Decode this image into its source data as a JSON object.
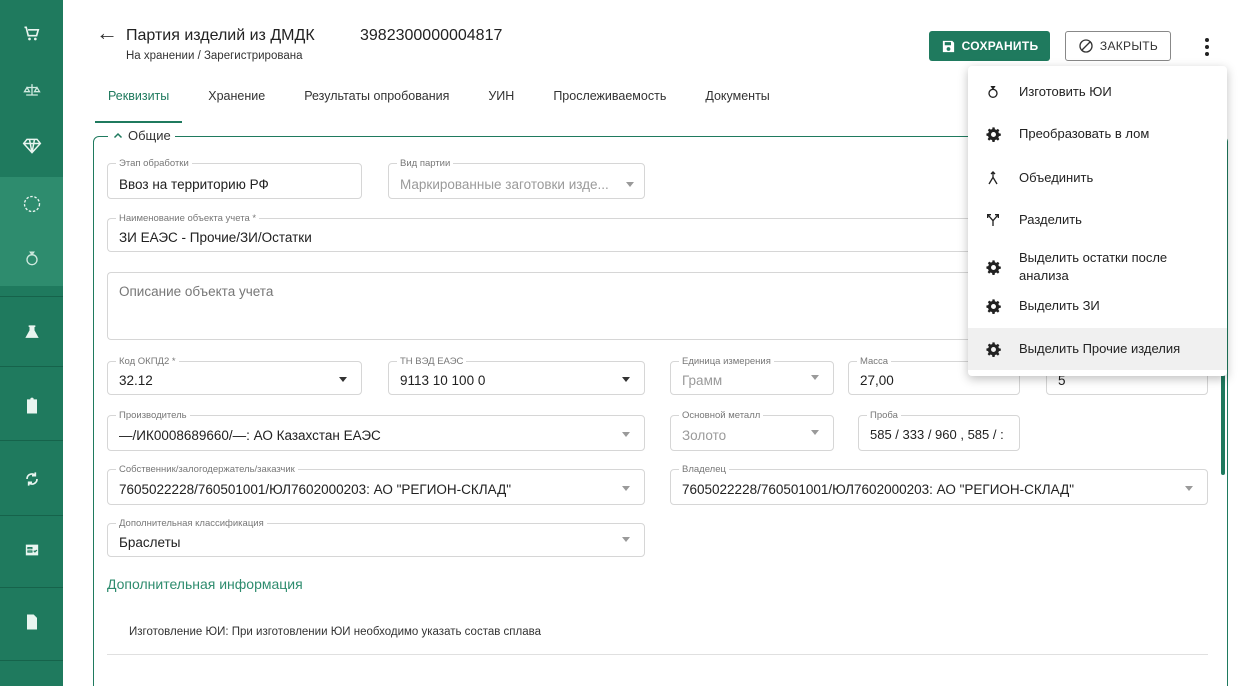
{
  "header": {
    "title": "Партия изделий из ДМДК",
    "doc_number": "3982300000004817",
    "subtitle": "На хранении / Зарегистрирована",
    "save_label": "СОХРАНИТЬ",
    "close_label": "ЗАКРЫТЬ"
  },
  "sidebar": {
    "items": [
      {
        "icon": "cart-icon"
      },
      {
        "icon": "scales-icon"
      },
      {
        "icon": "diamond-icon"
      },
      {
        "icon": "circle-dashed-icon"
      },
      {
        "icon": "ring-icon"
      },
      {
        "icon": "flask-icon"
      },
      {
        "icon": "clipboard-icon"
      },
      {
        "icon": "sync-icon"
      },
      {
        "icon": "checklist-icon"
      },
      {
        "icon": "document-icon"
      }
    ],
    "accent": "#1f7a5e"
  },
  "tabs": [
    "Реквизиты",
    "Хранение",
    "Результаты опробования",
    "УИН",
    "Прослеживаемость",
    "Документы"
  ],
  "section": {
    "title": "Общие"
  },
  "form": {
    "stage": {
      "label": "Этап обработки",
      "value": "Ввоз на территорию РФ"
    },
    "batch_type": {
      "label": "Вид партии",
      "value": "Маркированные заготовки изде..."
    },
    "object_name": {
      "label": "Наименование объекта учета *",
      "value": "ЗИ ЕАЭС - Прочие/ЗИ/Остатки"
    },
    "description": {
      "placeholder": "Описание объекта учета"
    },
    "okpd2": {
      "label": "Код ОКПД2 *",
      "value": "32.12"
    },
    "tn_ved": {
      "label": "ТН ВЭД ЕАЭС",
      "value": "9113 10 100 0"
    },
    "unit": {
      "label": "Единица измерения",
      "value": "Грамм"
    },
    "mass": {
      "label": "Масса",
      "value": "27,00"
    },
    "quantity": {
      "value": "5"
    },
    "manufacturer": {
      "label": "Производитель",
      "value": "—/ИК0008689660/—: АО Казахстан ЕАЭС"
    },
    "main_metal": {
      "label": "Основной металл",
      "value": "Золото"
    },
    "probe": {
      "label": "Проба",
      "value": "585 / 333 / 960 , 585 / :"
    },
    "owner_pledge": {
      "label": "Собственник/залогодержатель/заказчик",
      "value": "7605022228/760501001/ЮЛ7602000203: АО \"РЕГИОН-СКЛАД\""
    },
    "holder": {
      "label": "Владелец",
      "value": "7605022228/760501001/ЮЛ7602000203: АО \"РЕГИОН-СКЛАД\""
    },
    "extra_class": {
      "label": "Дополнительная классификация",
      "value": "Браслеты"
    }
  },
  "additional": {
    "title": "Дополнительная информация",
    "note": "Изготовление ЮИ: При изготовлении ЮИ необходимо указать состав сплава"
  },
  "menu": {
    "items": [
      {
        "label": "Изготовить ЮИ",
        "icon": "ring-icon"
      },
      {
        "label": "Преобразовать в лом",
        "icon": "gear-icon"
      },
      {
        "label": "Объединить",
        "icon": "merge-icon"
      },
      {
        "label": "Разделить",
        "icon": "split-icon"
      },
      {
        "label": "Выделить остатки после анализа",
        "icon": "gear-icon"
      },
      {
        "label": "Выделить ЗИ",
        "icon": "gear-icon"
      },
      {
        "label": "Выделить Прочие изделия",
        "icon": "gear-icon"
      }
    ],
    "highlighted_index": 6
  }
}
